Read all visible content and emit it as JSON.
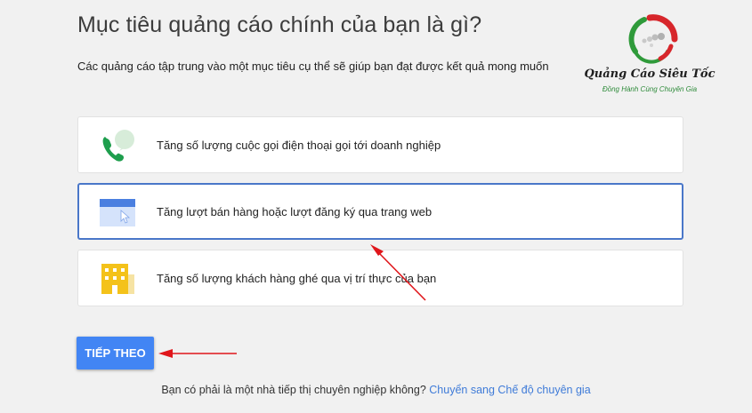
{
  "header": {
    "title": "Mục tiêu quảng cáo chính của bạn là gì?",
    "subtitle": "Các quảng cáo tập trung vào một mục tiêu cụ thể sẽ giúp bạn đạt được kết quả mong muốn"
  },
  "logo": {
    "name": "Quảng Cáo Siêu Tốc",
    "tagline": "Đồng Hành Cùng Chuyên Gia"
  },
  "goals": [
    {
      "label": "Tăng số lượng cuộc gọi điện thoại gọi tới doanh nghiệp",
      "icon": "phone-chat-icon",
      "selected": false
    },
    {
      "label": "Tăng lượt bán hàng hoặc lượt đăng ký qua trang web",
      "icon": "browser-cursor-icon",
      "selected": true
    },
    {
      "label": "Tăng số lượng khách hàng ghé qua vị trí thực của bạn",
      "icon": "storefront-icon",
      "selected": false
    }
  ],
  "actions": {
    "next_label": "TIẾP THEO"
  },
  "footer": {
    "question": "Bạn có phải là một nhà tiếp thị chuyên nghiệp không?",
    "link": "Chuyển sang Chế độ chuyên gia"
  },
  "colors": {
    "accent": "#4285f4",
    "selected_border": "#4a77c9",
    "link": "#3f7bd8",
    "annotation_arrow": "#e0161b",
    "background": "#f1f1f1"
  }
}
